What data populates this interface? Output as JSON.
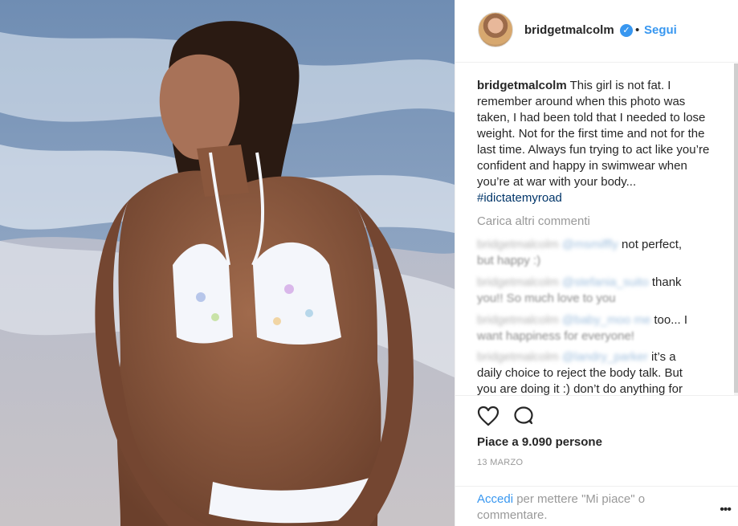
{
  "post": {
    "username": "bridgetmalcolm",
    "verified_icon": "verified-badge-icon",
    "separator": "•",
    "follow_label": "Segui",
    "caption_username": "bridgetmalcolm",
    "caption_text": "This girl is not fat. I remember around when this photo was taken, I had been told that I needed to lose weight. Not for the first time and not for the last time. Always fun trying to act like you’re confident and happy in swimwear when you’re at war with your body...",
    "caption_hashtag": "#idictatemyroad",
    "load_more": "Carica altri commenti",
    "comments": [
      {
        "user": "bridgetmalcolm",
        "mention": "@msmiffly",
        "text_a": "not perfect,",
        "text_b": "but happy :)"
      },
      {
        "user": "bridgetmalcolm",
        "mention": "@stefania_suito",
        "text_a": "thank",
        "text_b": "you!! So much love to you"
      },
      {
        "user": "bridgetmalcolm",
        "mention": "@baby_moo me",
        "text_a": "too... I",
        "text_b": "want happiness for everyone!"
      },
      {
        "user": "bridgetmalcolm",
        "mention": "@landry_parker",
        "text_a": "it’s a",
        "text_b": "daily choice to reject the body talk. But",
        "text_c": "you are doing it :) don’t do anything for"
      }
    ],
    "likes": "Piace a 9.090 persone",
    "date": "13 MARZO",
    "login_link": "Accedi",
    "login_text": "per mettere \"Mi piace\" o commentare.",
    "more_label": "•••",
    "icons": {
      "like": "heart-icon",
      "comment": "comment-icon",
      "more": "more-options-icon"
    },
    "colors": {
      "link_blue": "#3897f0",
      "hashtag_blue": "#003569",
      "muted_grey": "#999999",
      "text_dark": "#262626"
    }
  }
}
